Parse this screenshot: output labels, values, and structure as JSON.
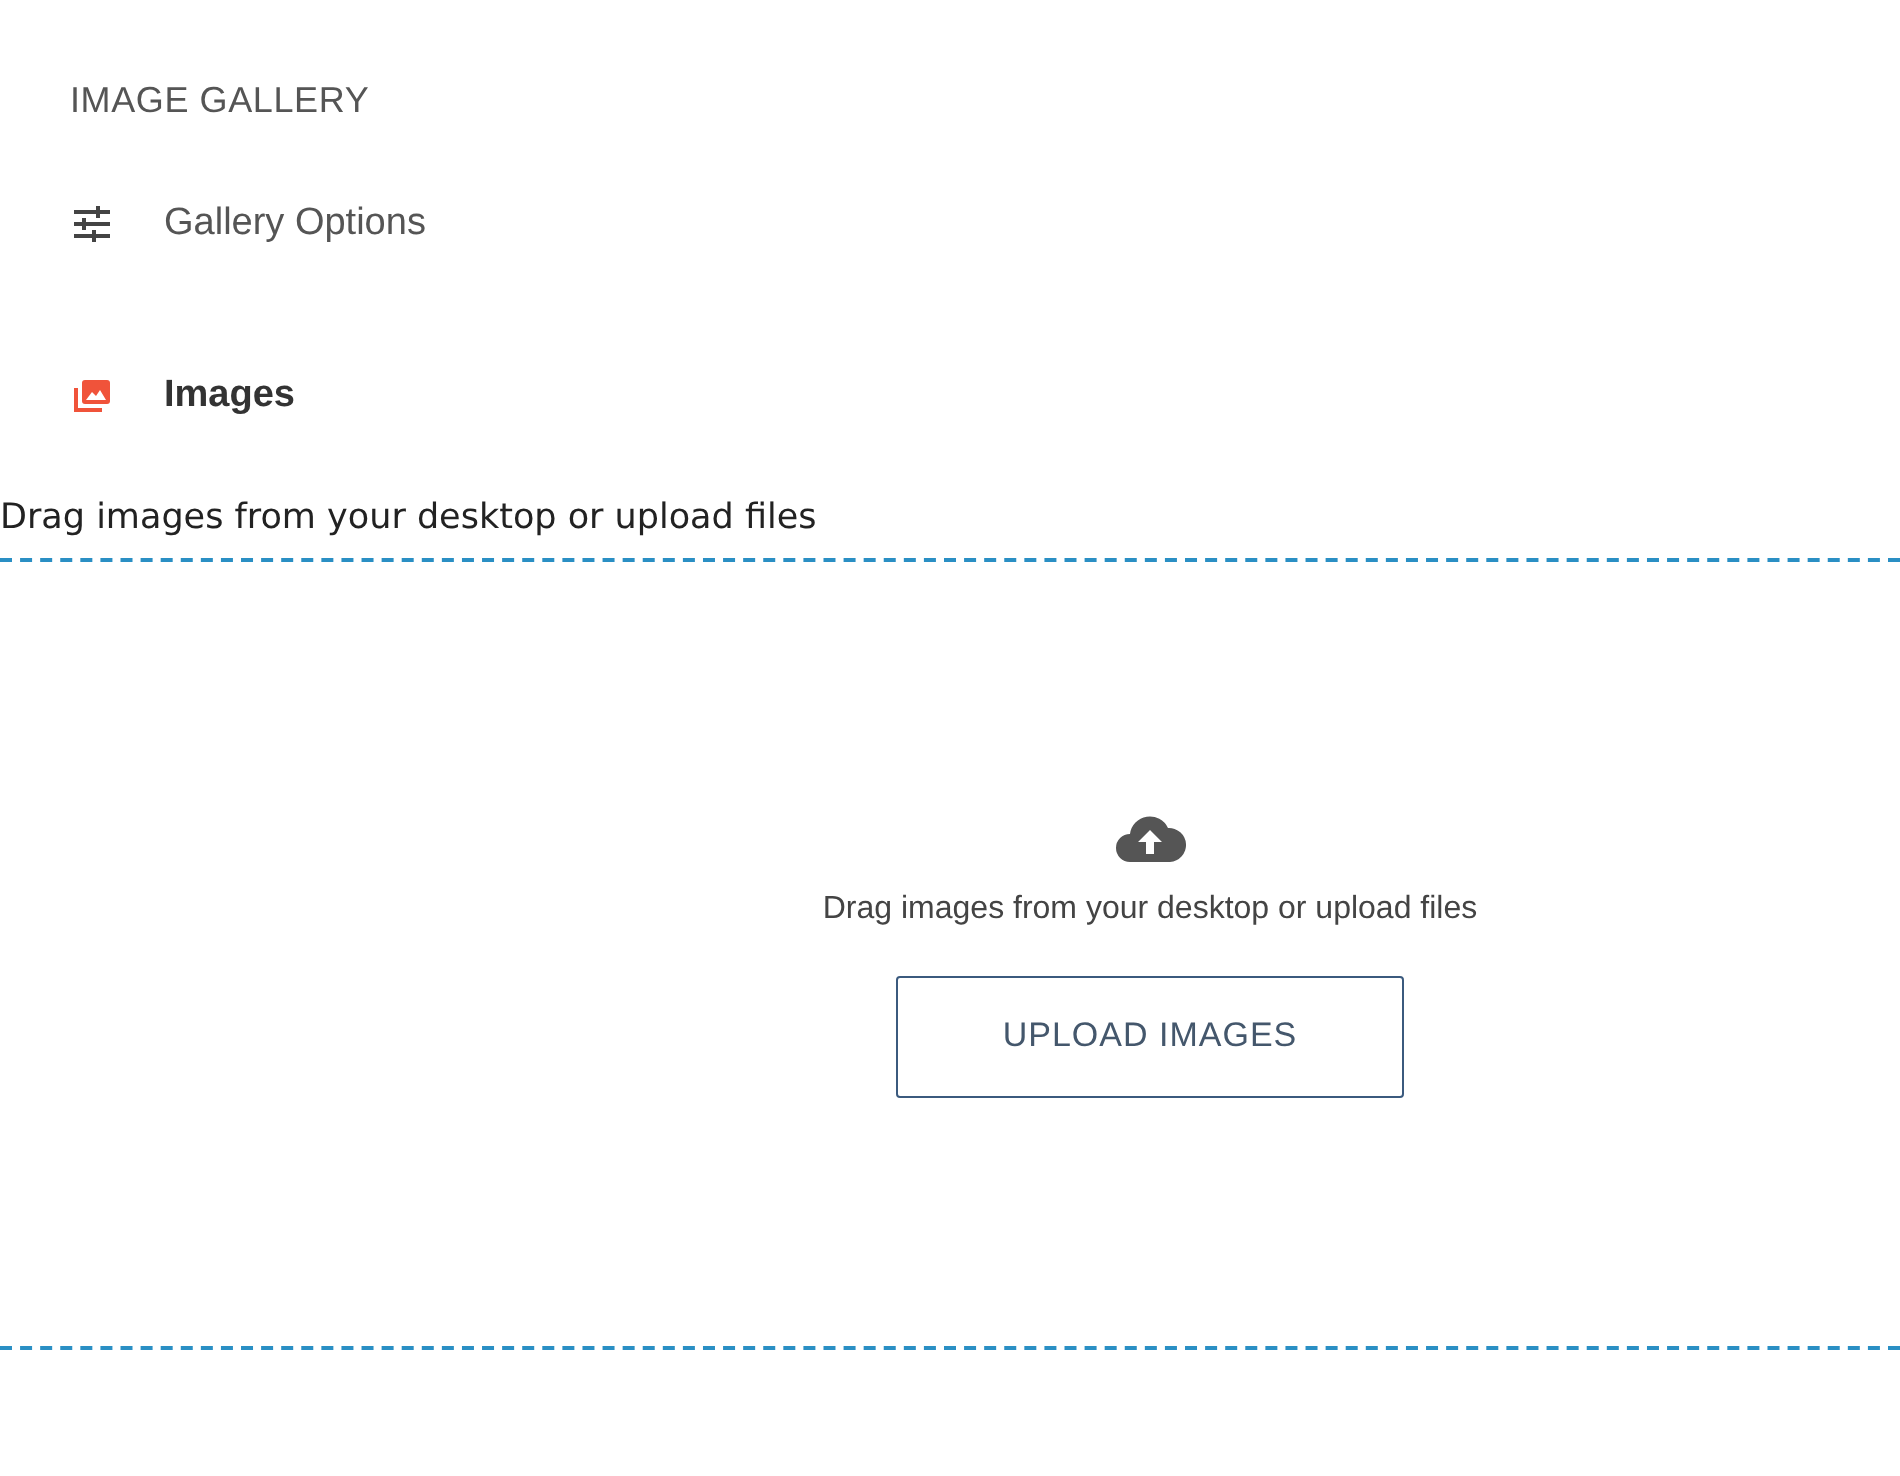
{
  "sidebar": {
    "title": "IMAGE GALLERY",
    "items": [
      {
        "label": "Gallery Options",
        "kind": "options",
        "selected": false
      },
      {
        "label": "Images",
        "kind": "images",
        "selected": true
      }
    ]
  },
  "intro": "Drag images from your desktop or upload files",
  "dropzone": {
    "hint": "Drag images from your desktop or upload files",
    "button": "UPLOAD IMAGES"
  }
}
